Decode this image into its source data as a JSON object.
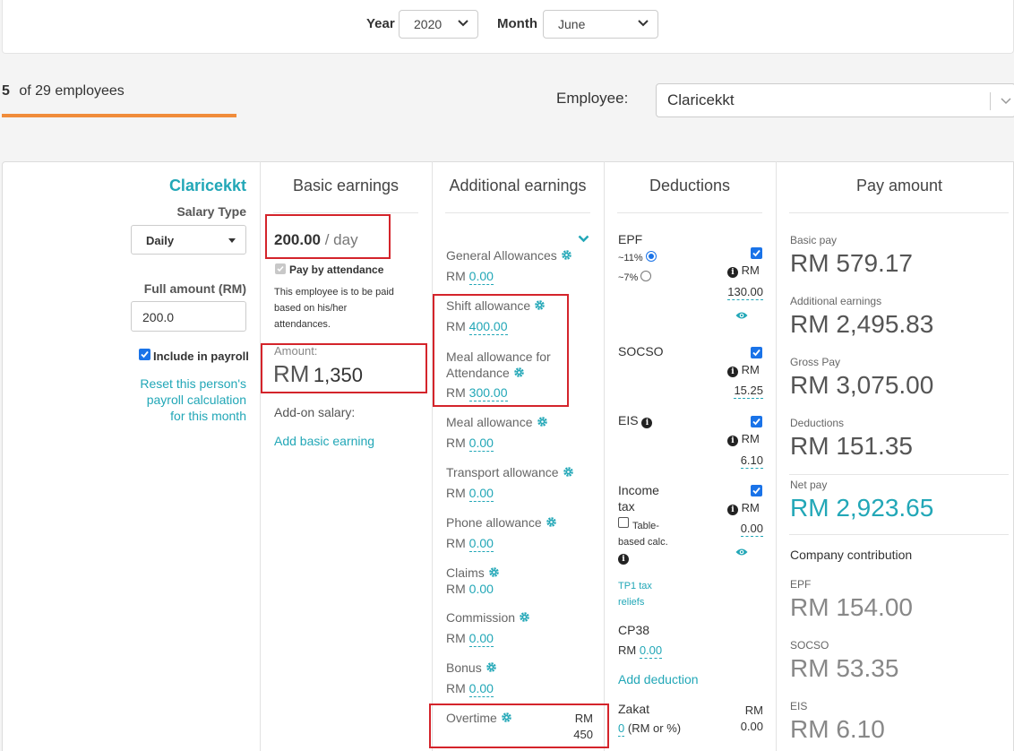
{
  "filters": {
    "year_label": "Year",
    "year_value": "2020",
    "month_label": "Month",
    "month_value": "June"
  },
  "nav": {
    "current": "5",
    "of_text": "of 29 employees",
    "employee_label": "Employee:",
    "employee_value": "Claricekkt"
  },
  "profile": {
    "name": "Claricekkt",
    "salary_type_label": "Salary Type",
    "salary_type_value": "Daily",
    "full_amount_label": "Full amount (RM)",
    "full_amount_value": "200.0",
    "include_label": "Include in payroll",
    "reset_line1": "Reset this person's",
    "reset_line2": "payroll calculation",
    "reset_line3": "for this month"
  },
  "basic": {
    "header": "Basic earnings",
    "rate": "200.00",
    "rate_unit": "/ day",
    "pay_by_attendance": "Pay by attendance",
    "note_line1": "This employee is to be paid",
    "note_line2": "based on his/her",
    "note_line3": "attendances.",
    "amount_label": "Amount:",
    "amount_currency": "RM",
    "amount_value": "1,350",
    "addon_label": "Add-on salary:",
    "add_link": "Add basic earning"
  },
  "additional": {
    "header": "Additional earnings",
    "items": [
      {
        "label": "General Allowances",
        "currency": "RM",
        "value": "0.00"
      },
      {
        "label": "Shift allowance",
        "currency": "RM",
        "value": "400.00"
      },
      {
        "label_line1": "Meal allowance for",
        "label_line2": "Attendance",
        "currency": "RM",
        "value": "300.00"
      },
      {
        "label": "Meal allowance",
        "currency": "RM",
        "value": "0.00"
      },
      {
        "label": "Transport allowance",
        "currency": "RM",
        "value": "0.00"
      },
      {
        "label": "Phone allowance",
        "currency": "RM",
        "value": "0.00"
      },
      {
        "label": "Claims",
        "currency": "RM",
        "value": "0.00"
      },
      {
        "label": "Commission",
        "currency": "RM",
        "value": "0.00"
      },
      {
        "label": "Bonus",
        "currency": "RM",
        "value": "0.00"
      },
      {
        "label": "Overtime",
        "currency": "RM",
        "value": "450"
      }
    ]
  },
  "deductions": {
    "header": "Deductions",
    "epf_label": "EPF",
    "epf_opt1": "~11%",
    "epf_opt2": "~7%",
    "epf_currency": "RM",
    "epf_value": "130.00",
    "socso_label": "SOCSO",
    "socso_currency": "RM",
    "socso_value": "15.25",
    "eis_label": "EIS",
    "eis_currency": "RM",
    "eis_value": "6.10",
    "tax_line1": "Income",
    "tax_line2": "tax",
    "tax_table_line1": "Table-",
    "tax_table_line2": "based calc.",
    "tax_currency": "RM",
    "tax_value": "0.00",
    "tp1_line1": "TP1 tax",
    "tp1_line2": "reliefs",
    "cp38_label": "CP38",
    "cp38_currency": "RM",
    "cp38_value": "0.00",
    "add_deduction": "Add deduction",
    "zakat_label": "Zakat",
    "zakat_value": "0",
    "zakat_hint": "(RM or %)",
    "zakat_currency": "RM",
    "zakat_amount": "0.00"
  },
  "pay": {
    "header": "Pay amount",
    "basic_label": "Basic pay",
    "basic_value": "RM 579.17",
    "additional_label": "Additional earnings",
    "additional_value": "RM 2,495.83",
    "gross_label": "Gross Pay",
    "gross_value": "RM 3,075.00",
    "deductions_label": "Deductions",
    "deductions_value": "RM 151.35",
    "net_label": "Net pay",
    "net_value": "RM 2,923.65",
    "company_label": "Company contribution",
    "epf_label": "EPF",
    "epf_value": "RM 154.00",
    "socso_label": "SOCSO",
    "socso_value": "RM 53.35",
    "eis_label": "EIS",
    "eis_value": "RM 6.10"
  },
  "colors": {
    "accent": "#22a7b7",
    "progress": "#f08c3a",
    "highlight": "#d4242b",
    "checkbox": "#1a73e8"
  }
}
